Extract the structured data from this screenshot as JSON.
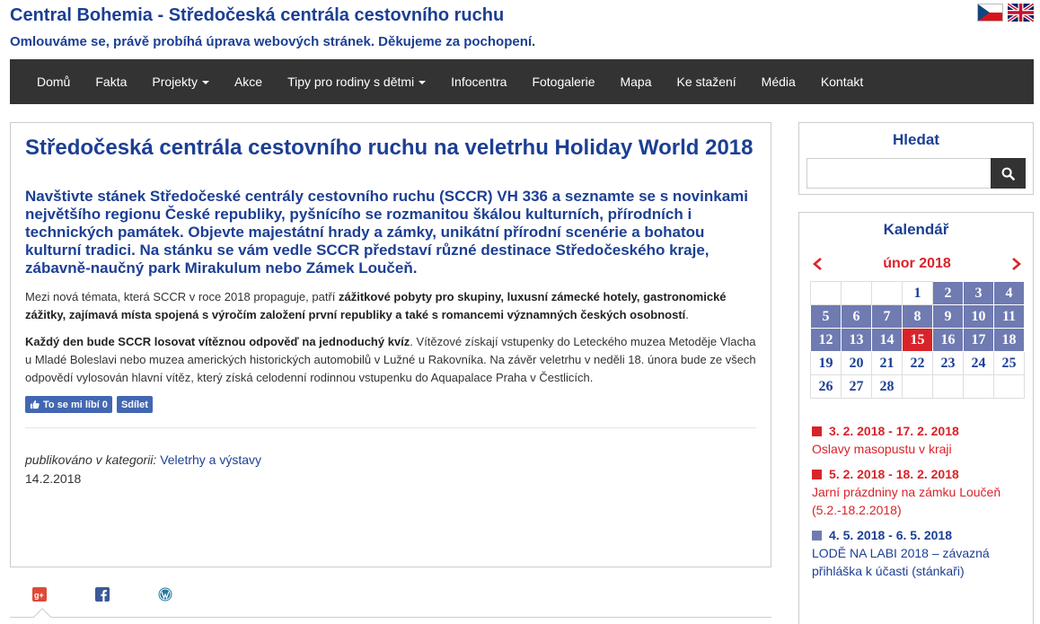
{
  "header": {
    "title": "Central Bohemia - Středočeská centrála cestovního ruchu",
    "notice": "Omlouváme se, právě probíhá úprava webových stránek. Děkujeme za pochopení."
  },
  "nav": {
    "home": "Domů",
    "facts": "Fakta",
    "projects": "Projekty",
    "events": "Akce",
    "family_tips": "Tipy pro rodiny s dětmi",
    "info_centers": "Infocentra",
    "gallery": "Fotogalerie",
    "map": "Mapa",
    "downloads": "Ke stažení",
    "media": "Média",
    "contact": "Kontakt"
  },
  "article": {
    "title": "Středočeská centrála cestovního ruchu na veletrhu Holiday World 2018",
    "lead": "Navštivte stánek Středočeské centrály cestovního ruchu (SCCR) VH 336 a seznamte se s novinkami největšího regionu České republiky, pyšnícího se rozmanitou škálou kulturních, přírodních i technických památek. Objevte majestátní hrady a zámky, unikátní přírodní scenérie a bohatou kulturní tradici. Na stánku se vám vedle SCCR představí různé destinace Středočeského kraje, zábavně-naučný park Mirakulum nebo Zámek Loučeň.",
    "p1_start": " Mezi nová témata, která SCCR v roce 2018 propaguje, patří ",
    "p1_bold": "zážitkové pobyty pro skupiny, luxusní zámecké hotely, gastronomické zážitky, zajímavá místa spojená s výročím založení první republiky a také s romancemi významných českých osobností",
    "p1_end": ".",
    "p2_bold": "Každý den bude SCCR losovat vítěznou odpověď na jednoduchý kvíz",
    "p2_rest": ". Vítězové získají vstupenky do Leteckého muzea Metoděje Vlacha u Mladé Boleslavi nebo muzea amerických historických automobilů v Lužné u Rakovníka. Na závěr veletrhu v neděli 18. února bude ze všech odpovědí vylosován hlavní vítěz, který získá celodenní rodinnou vstupenku do Aquapalace Praha v Čestlicích.",
    "like_label": "To se mi líbí 0",
    "share_label": "Sdílet",
    "category_label": "publikováno v kategorii:",
    "category": "Veletrhy a výstavy",
    "date": "14.2.2018"
  },
  "search": {
    "title": "Hledat",
    "placeholder": ""
  },
  "calendar": {
    "title": "Kalendář",
    "month": "únor 2018",
    "weeks": [
      [
        "",
        "",
        "",
        "1",
        "2",
        "3",
        "4"
      ],
      [
        "5",
        "6",
        "7",
        "8",
        "9",
        "10",
        "11"
      ],
      [
        "12",
        "13",
        "14",
        "15",
        "16",
        "17",
        "18"
      ],
      [
        "19",
        "20",
        "21",
        "22",
        "23",
        "24",
        "25"
      ],
      [
        "26",
        "27",
        "28",
        "",
        "",
        "",
        ""
      ]
    ],
    "event_days": [
      "2",
      "3",
      "4",
      "5",
      "6",
      "7",
      "8",
      "9",
      "10",
      "11",
      "12",
      "13",
      "14",
      "16",
      "17",
      "18"
    ],
    "today": "15",
    "events": [
      {
        "date": "3. 2. 2018 - 17. 2. 2018",
        "name": "Oslavy masopustu v kraji",
        "color": "red"
      },
      {
        "date": "5. 2. 2018 - 18. 2. 2018",
        "name": "Jarní prázdniny na zámku Loučeň (5.2.-18.2.2018)",
        "color": "red"
      },
      {
        "date": "4. 5. 2018 - 6. 5. 2018",
        "name": "LODĚ NA LABI 2018 – závazná přihláška k účasti (stánkaři)",
        "color": "blue"
      }
    ]
  },
  "colors": {
    "brand_blue": "#1c3f94",
    "accent_red": "#d9232a",
    "event_blue": "#6f7bb1",
    "nav_bg": "#333333"
  }
}
